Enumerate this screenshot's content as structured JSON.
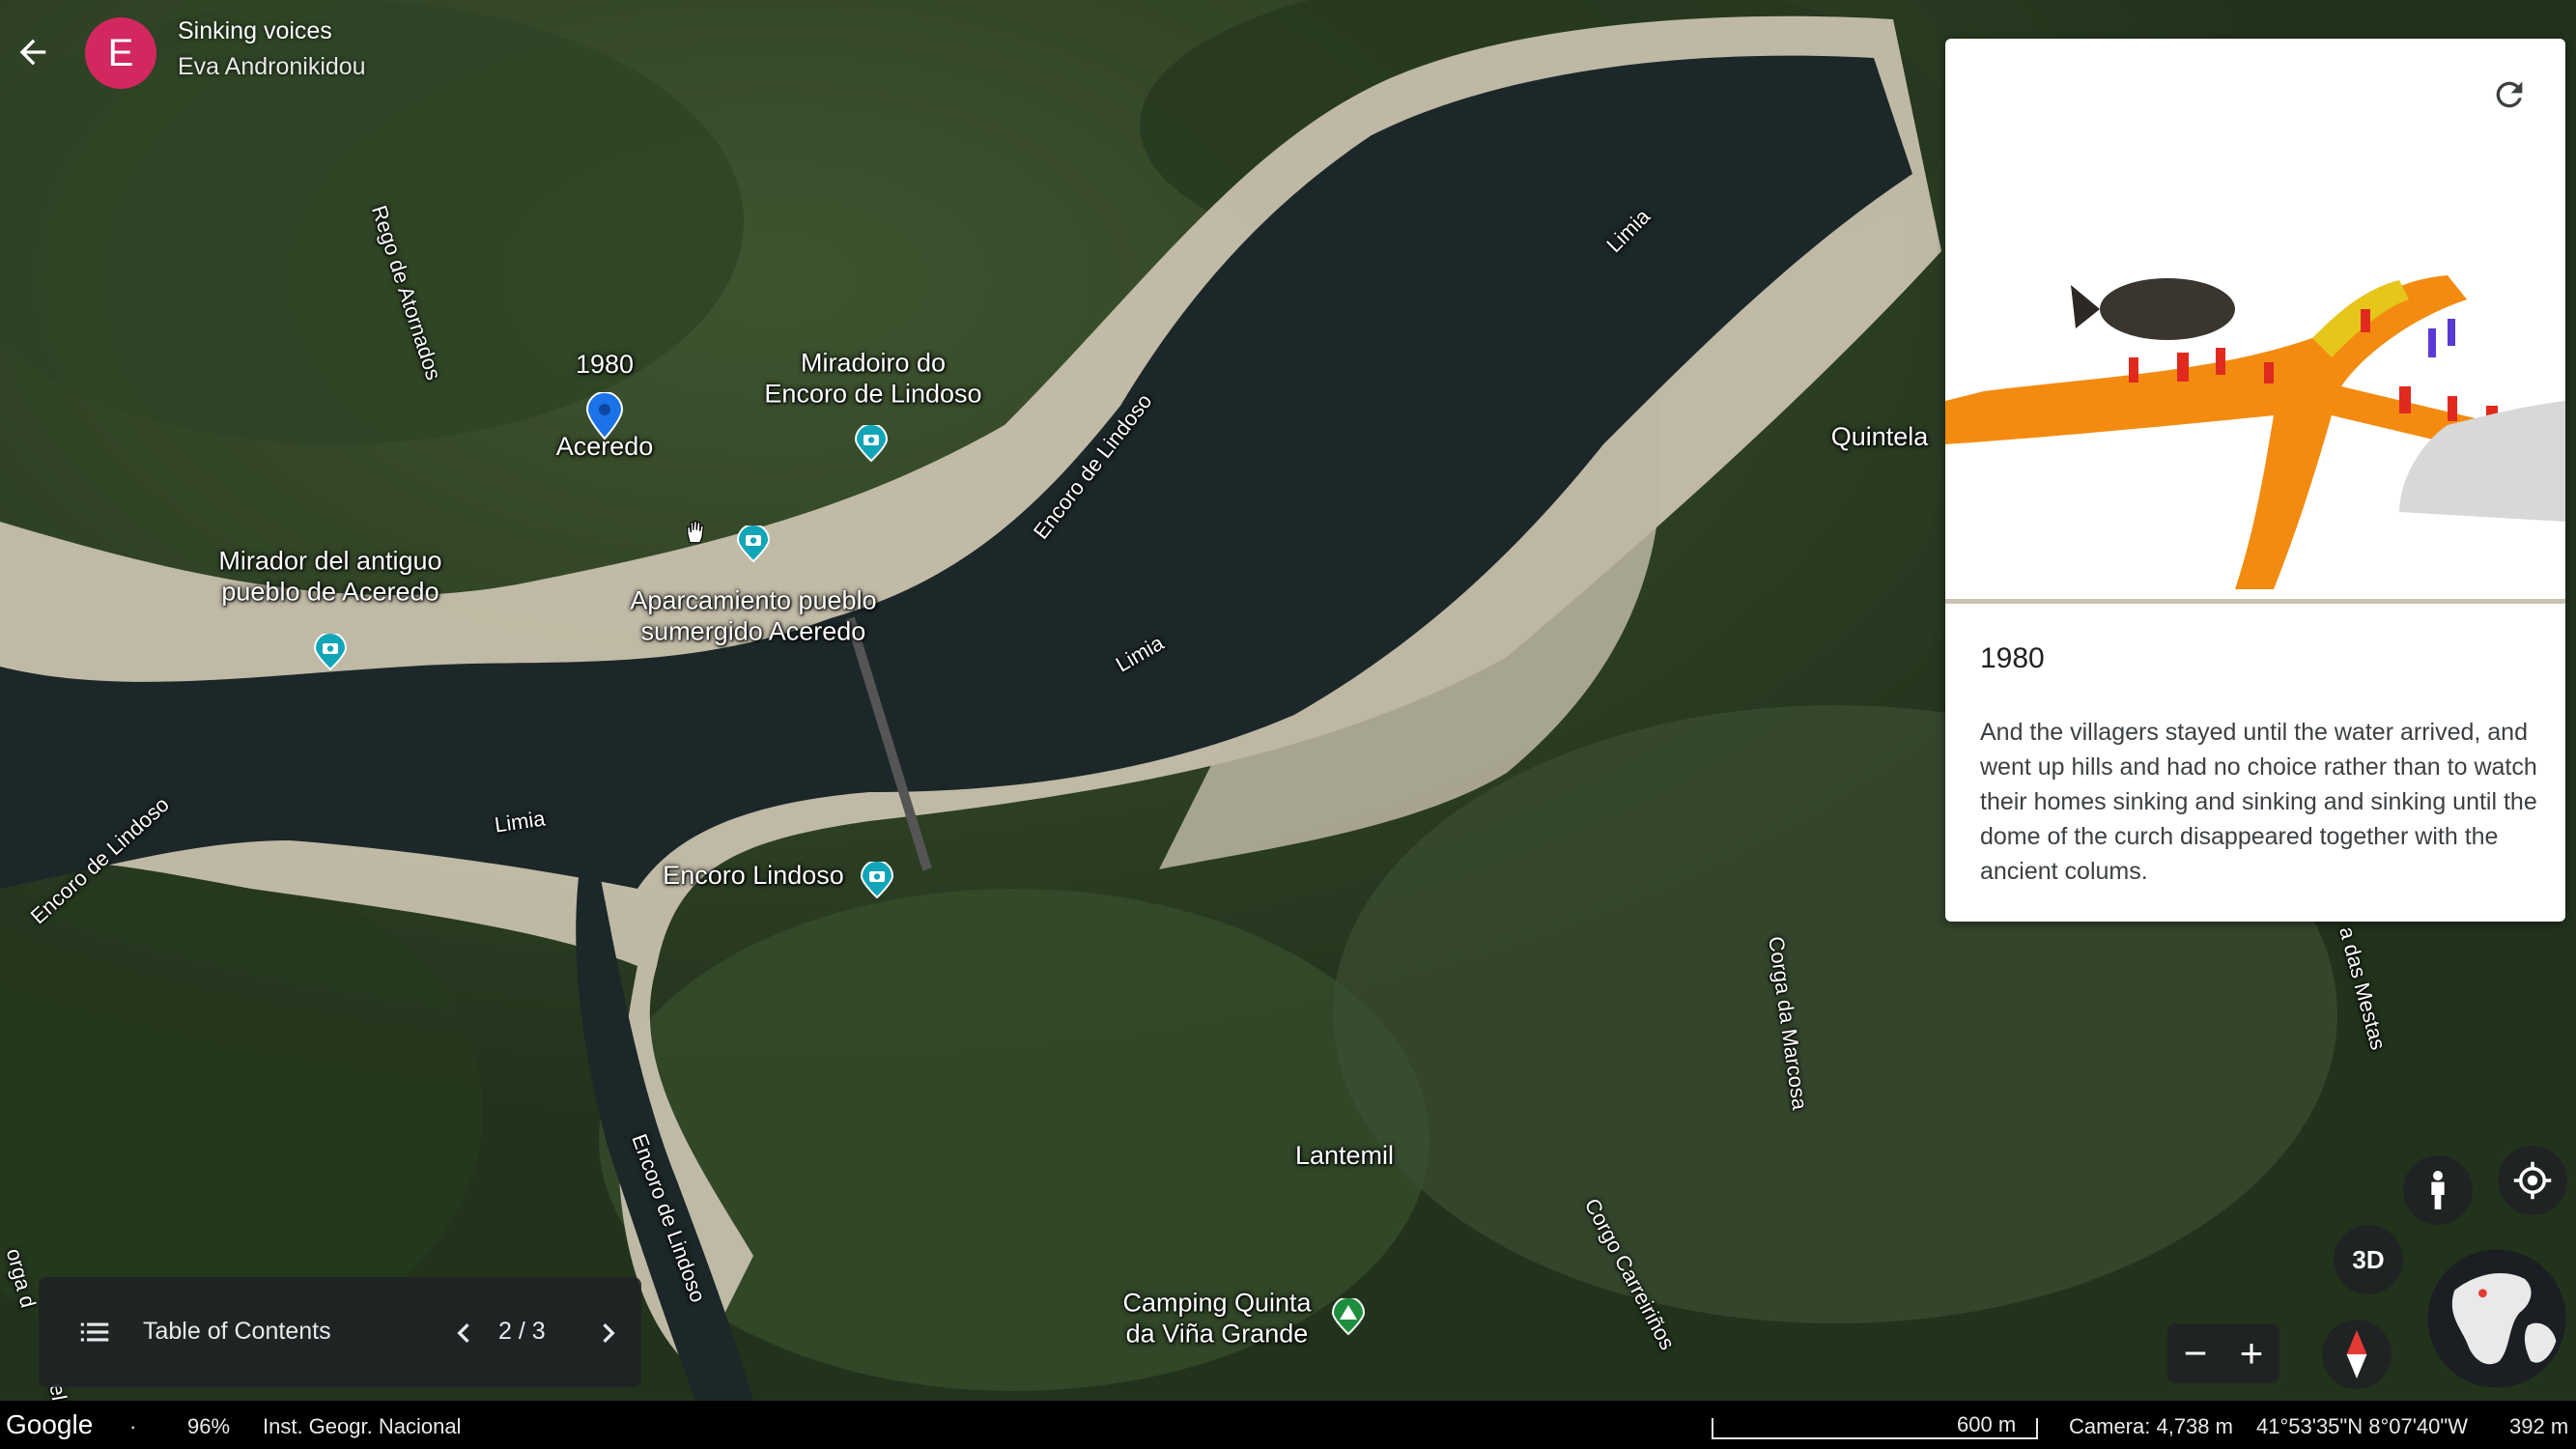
{
  "header": {
    "avatar_letter": "E",
    "title": "Sinking voices",
    "author": "Eva Andronikidou"
  },
  "map": {
    "places": [
      {
        "key": "acer1980",
        "text": "1980"
      },
      {
        "key": "aceredo",
        "text": "Aceredo"
      },
      {
        "key": "miradoiro",
        "text": "Miradoiro do\nEncoro de Lindoso"
      },
      {
        "key": "mirador",
        "text": "Mirador del antiguo\npueblo de Aceredo"
      },
      {
        "key": "aparcamiento",
        "text": "Aparcamiento pueblo\nsumergido Aceredo"
      },
      {
        "key": "encoro",
        "text": "Encoro Lindoso"
      },
      {
        "key": "quintela",
        "text": "Quintela"
      },
      {
        "key": "lantemil",
        "text": "Lantemil"
      },
      {
        "key": "camping",
        "text": "Camping Quinta\nda Viña Grande"
      }
    ],
    "roads": [
      {
        "key": "rego",
        "text": "Rego de Atornados"
      },
      {
        "key": "limia1",
        "text": "Limia"
      },
      {
        "key": "limia2",
        "text": "Limia"
      },
      {
        "key": "limia3",
        "text": "Limia"
      },
      {
        "key": "encoroLindoso1",
        "text": "Encoro de Lindoso"
      },
      {
        "key": "encoroLindoso2",
        "text": "Encoro de Lindoso"
      },
      {
        "key": "encoroLindoso3",
        "text": "Encoro de Lindoso"
      },
      {
        "key": "corgaMarcosa",
        "text": "Corga da Marcosa"
      },
      {
        "key": "corgoCarreirinos",
        "text": "Corgo Carreiriños"
      },
      {
        "key": "dasMestas",
        "text": "a das Mestas"
      },
      {
        "key": "corgaLeft",
        "text": "orga d"
      },
      {
        "key": "ela",
        "text": "ela"
      }
    ]
  },
  "card": {
    "title": "1980",
    "body": "And the villagers stayed until the water arrived, and went up hills and had no choice rather than to watch their homes sinking and sinking and sinking until the dome of the curch disappeared together with the ancient colums."
  },
  "toc": {
    "label": "Table of Contents",
    "page": "2 / 3"
  },
  "controls": {
    "btn_3d": "3D",
    "zoom_out": "−",
    "zoom_in": "+"
  },
  "status": {
    "logo": "Google",
    "dot": "·",
    "loading": "96%",
    "attribution": "Inst. Geogr. Nacional",
    "scale": "600 m",
    "camera": "Camera: 4,738 m",
    "coords": "41°53'35\"N 8°07'40\"W",
    "elevation": "392 m"
  },
  "colors": {
    "avatar": "#d3275f",
    "pin_blue": "#1a73e8",
    "poi_teal": "#12a5b8",
    "camping_green": "#1e8e3e"
  }
}
